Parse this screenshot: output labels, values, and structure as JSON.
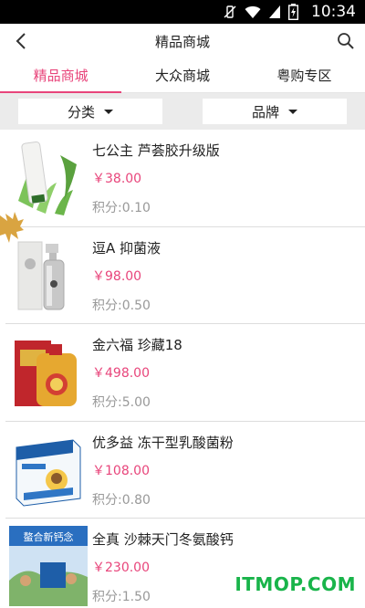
{
  "status": {
    "time": "10:34"
  },
  "header": {
    "title": "精品商城"
  },
  "tabs": [
    {
      "label": "精品商城",
      "active": true
    },
    {
      "label": "大众商城",
      "active": false
    },
    {
      "label": "粤购专区",
      "active": false
    }
  ],
  "filters": [
    {
      "label": "分类"
    },
    {
      "label": "品牌"
    }
  ],
  "products": [
    {
      "name": "七公主 芦荟胶升级版",
      "price": "￥38.00",
      "points": "积分:0.10"
    },
    {
      "name": "逗A  抑菌液",
      "price": "￥98.00",
      "points": "积分:0.50"
    },
    {
      "name": "金六福  珍藏18",
      "price": "￥498.00",
      "points": "积分:5.00"
    },
    {
      "name": "优多益  冻干型乳酸菌粉",
      "price": "￥108.00",
      "points": "积分:0.80"
    },
    {
      "name": "全真  沙棘天门冬氨酸钙",
      "price": "￥230.00",
      "points": "积分:1.50"
    }
  ],
  "thumb_text": {
    "p5_top": "螯合新钙念"
  },
  "watermark": "ITMOP.COM",
  "colors": {
    "accent": "#e8457b",
    "watermark": "#19b44a"
  }
}
